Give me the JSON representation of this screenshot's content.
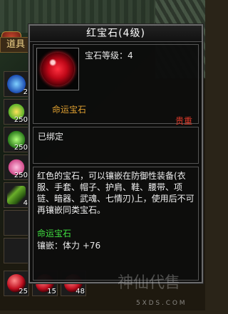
{
  "inventory": {
    "tab_label": "道具",
    "slots": [
      {
        "icon": "blue-crystal-icon",
        "count": "2"
      },
      {
        "icon": "yellow-flower-icon",
        "count": "250"
      },
      {
        "icon": "green-orb-icon",
        "count": "250"
      },
      {
        "icon": "pink-flower-icon",
        "count": "250"
      },
      {
        "icon": "green-leaf-icon",
        "count": "4"
      }
    ],
    "bottom_slots": [
      {
        "icon": "red-gem-icon",
        "count": "25"
      },
      {
        "icon": "red-gem-icon",
        "count": "15"
      },
      {
        "icon": "red-gem-icon",
        "count": "48"
      }
    ]
  },
  "tooltip": {
    "title": "红宝石(4级)",
    "level_line": "宝石等级：4",
    "set_name": "命运宝石",
    "rarity": "贵重",
    "bind_status": "已绑定",
    "description": "红色的宝石，可以镶嵌在防御性装备(衣服、手套、帽子、护肩、鞋、腰带、项链、暗器、武魂、七情刃)上，使用后不可再镶嵌同类宝石。",
    "set_line": "命运宝石",
    "inlay_line": "镶嵌：体力 +76"
  },
  "watermark": {
    "logo_text": "神仙代售",
    "url": "5 X D S . C O M"
  }
}
